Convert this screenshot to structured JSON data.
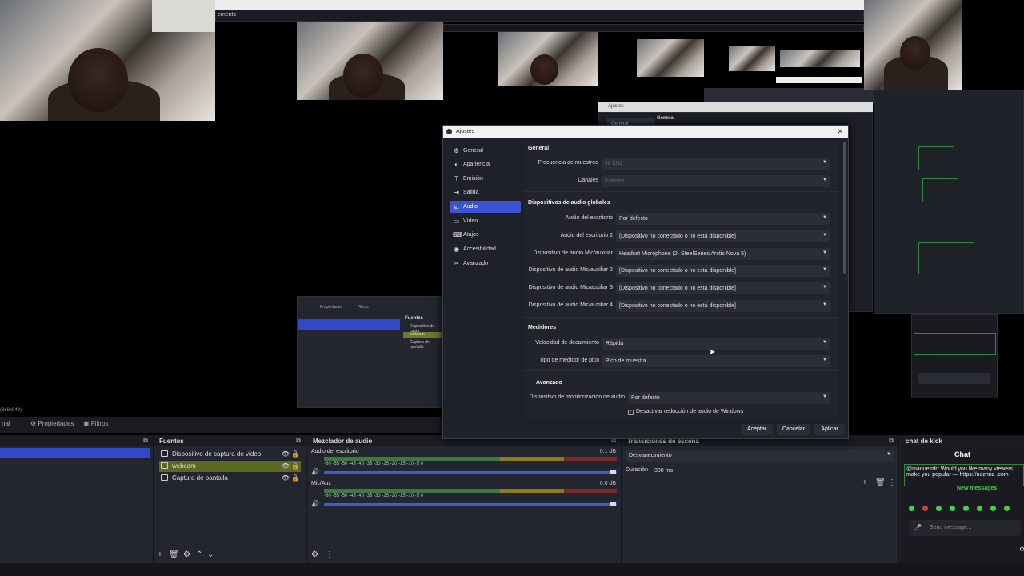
{
  "background": {
    "nested_title": "ements",
    "nested_small_title": "Ajustes",
    "nested_general": "General",
    "left_tabs": [
      "Propiedades",
      "Filtros"
    ],
    "mini_sources": [
      "Dispositivo de captu",
      "webcam",
      "Captura de pantalla"
    ],
    "mini_sources_header": "Fuentes",
    "resolution": "(668x948)"
  },
  "bottom": {
    "tabs": {
      "left": "nal",
      "properties": "Propiedades",
      "filters": "Filtros"
    },
    "sources": {
      "title": "Fuentes",
      "items": [
        {
          "label": "Dispositivo de captura de video",
          "icon": "camera-icon"
        },
        {
          "label": "webcam",
          "icon": "camera-icon"
        },
        {
          "label": "Captura de pantalla",
          "icon": "monitor-icon"
        }
      ]
    },
    "mixer": {
      "title": "Mezclador de audio",
      "channels": [
        {
          "name": "Audio del escritorio",
          "db": "0.1 dB"
        },
        {
          "name": "Mic/Aux",
          "db": "0.0 dB"
        }
      ],
      "ticks": "-60  -55  -50  -45  -40  -35  -30  -25  -20  -15  -10   -5    0"
    },
    "transitions": {
      "title": "Transiciones de escena",
      "selected": "Desvanecimiento",
      "duration_label": "Duración",
      "duration_value": "300 ms"
    },
    "chat": {
      "dock_title": "chat de kick",
      "title": "Chat",
      "message": "@manuelrdrr Would you like many viewers make you popular — https://nezhna .com",
      "new_messages": "New messages",
      "placeholder": "Send message..."
    }
  },
  "dialog": {
    "title": "Ajustes",
    "nav": [
      {
        "label": "General",
        "icon": "gear-icon"
      },
      {
        "label": "Apariencia",
        "icon": "palette-icon"
      },
      {
        "label": "Emisión",
        "icon": "antenna-icon"
      },
      {
        "label": "Salida",
        "icon": "output-icon"
      },
      {
        "label": "Audio",
        "icon": "speaker-icon"
      },
      {
        "label": "Vídeo",
        "icon": "monitor-icon"
      },
      {
        "label": "Atajos",
        "icon": "keyboard-icon"
      },
      {
        "label": "Accesibilidad",
        "icon": "accessibility-icon"
      },
      {
        "label": "Avanzado",
        "icon": "wrench-icon"
      }
    ],
    "active_nav": "Audio",
    "sections": {
      "general": "General",
      "global_devices": "Dispositivos de audio globales",
      "meters": "Medidores",
      "advanced": "Avanzado"
    },
    "fields": {
      "sample_rate": {
        "label": "Frecuencia de muestreo",
        "value": "48 kHz"
      },
      "channels": {
        "label": "Canales",
        "value": "Estéreo"
      },
      "desktop_audio": {
        "label": "Audio del escritorio",
        "value": "Por defecto"
      },
      "desktop_audio_2": {
        "label": "Audio del escritorio 2",
        "value": "[Dispositivo no conectado o no está disponible]"
      },
      "mic_aux": {
        "label": "Dispositivo de audio Mic/auxiliar",
        "value": "Headset Microphone (2- SteelSeries Arctis Nova 5)"
      },
      "mic_aux_2": {
        "label": "Dispositivo de audio Mic/auxiliar 2",
        "value": "[Dispositivo no conectado o no está disponible]"
      },
      "mic_aux_3": {
        "label": "Dispositivo de audio Mic/auxiliar 3",
        "value": "[Dispositivo no conectado o no está disponible]"
      },
      "mic_aux_4": {
        "label": "Dispositivo de audio Mic/auxiliar 4",
        "value": "[Dispositivo no conectado o no está disponible]"
      },
      "decay_rate": {
        "label": "Velocidad de decaimiento",
        "value": "Rápida"
      },
      "peak_meter": {
        "label": "Tipo de medidor de pico",
        "value": "Pico de muestra"
      },
      "monitoring": {
        "label": "Dispositivo de monitorización de audio",
        "value": "Por defecto"
      },
      "ducking": {
        "label": "Desactivar reducción de audio de Windows",
        "checked": true
      }
    },
    "buttons": {
      "accept": "Aceptar",
      "cancel": "Cancelar",
      "apply": "Aplicar"
    },
    "accent_color": "#3d52d5"
  }
}
